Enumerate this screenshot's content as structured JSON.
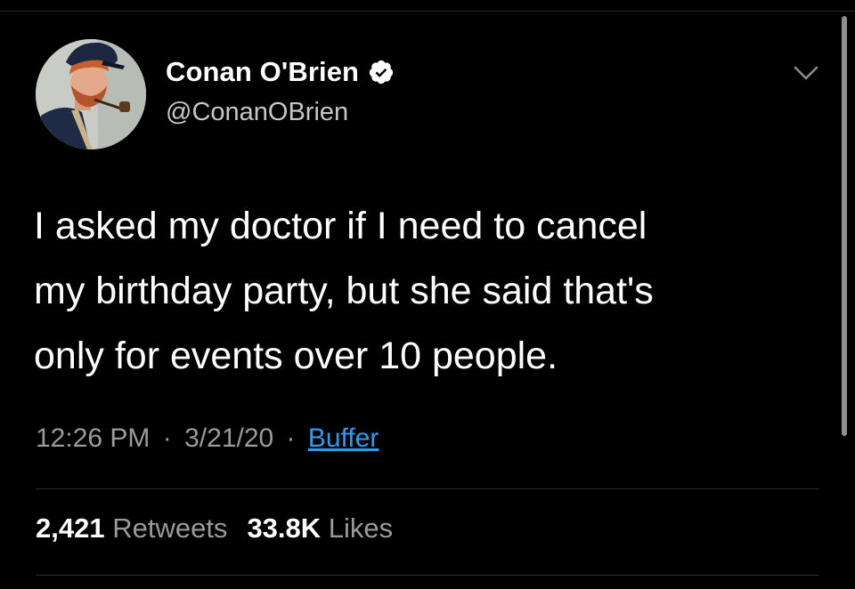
{
  "tweet": {
    "author": {
      "display_name": "Conan O'Brien",
      "handle": "@ConanOBrien",
      "verified": true
    },
    "text_lines": [
      "I asked my doctor if I need to cancel",
      "my birthday party, but she said that's",
      "only for events over 10 people."
    ],
    "time": "12:26 PM",
    "separator": "·",
    "date": "3/21/20",
    "source": "Buffer",
    "stats": {
      "retweets_count": "2,421",
      "retweets_label": "Retweets",
      "likes_count": "33.8K",
      "likes_label": "Likes"
    }
  },
  "icons": {
    "verified": "verified-badge-icon",
    "menu": "chevron-down-icon"
  },
  "colors": {
    "background": "#000000",
    "text": "#ffffff",
    "secondary_text": "#9a9a9a",
    "link": "#2f9bf0",
    "divider": "#2f2f2f"
  }
}
